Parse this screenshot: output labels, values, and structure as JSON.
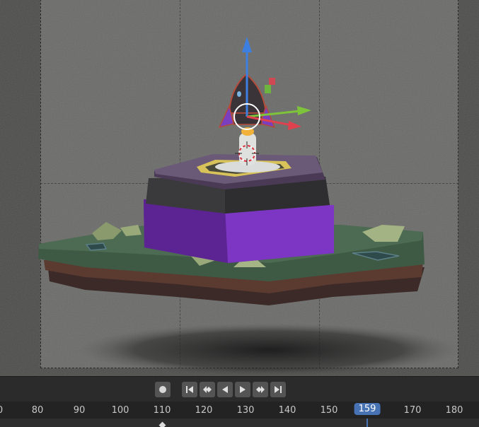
{
  "viewport": {
    "background": "#5a5b58",
    "scene_object": "rocket-on-launch-island",
    "gizmo_colors": {
      "z": "#3d7fe0",
      "y": "#7ec43a",
      "x": "#e0414e"
    }
  },
  "playback": {
    "record_icon": "record-icon",
    "buttons": [
      {
        "name": "jump-to-start-icon"
      },
      {
        "name": "jump-to-prev-keyframe-icon"
      },
      {
        "name": "play-reverse-icon"
      },
      {
        "name": "play-icon"
      },
      {
        "name": "jump-to-next-keyframe-icon"
      },
      {
        "name": "jump-to-end-icon"
      }
    ]
  },
  "timeline": {
    "ticks": [
      "0",
      "80",
      "90",
      "100",
      "110",
      "120",
      "130",
      "140",
      "150",
      "170",
      "180"
    ],
    "current_frame": "159",
    "accent": "#4772b3"
  }
}
